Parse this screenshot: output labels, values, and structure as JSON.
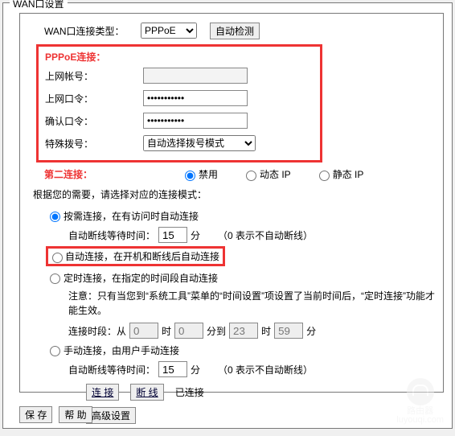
{
  "title": "WAN口设置",
  "wan_type": {
    "label": "WAN口连接类型：",
    "selected": "PPPoE",
    "auto_detect": "自动检测"
  },
  "pppoe": {
    "title": "PPPoE连接：",
    "user_label": "上网帐号：",
    "user_value": "",
    "pass_label": "上网口令：",
    "pass_value": "•••••••••••",
    "confirm_label": "确认口令：",
    "confirm_value": "•••••••••••",
    "dial_label": "特殊拨号：",
    "dial_selected": "自动选择拨号模式"
  },
  "second_conn": {
    "label": "第二连接：",
    "opt_disable": "禁用",
    "opt_dynamic": "动态 IP",
    "opt_static": "静态 IP",
    "selected": "disable"
  },
  "desc_text": "根据您的需要，请选择对应的连接模式：",
  "modes": {
    "ondemand": {
      "label": "按需连接，在有访问时自动连接",
      "wait_label": "自动断线等待时间：",
      "wait_value": "15",
      "wait_unit": "分",
      "wait_note": "（0 表示不自动断线）"
    },
    "auto": {
      "label": "自动连接，在开机和断线后自动连接"
    },
    "timed": {
      "label": "定时连接，在指定的时间段自动连接",
      "note": "注意：只有当您到“系统工具”菜单的“时间设置”项设置了当前时间后，“定时连接”功能才能生效。",
      "period_label": "连接时段：从",
      "from_h": "0",
      "h_unit": "时",
      "from_m": "0",
      "m_unit": "分到",
      "to_h": "23",
      "to_h_unit": "时",
      "to_m": "59",
      "to_m_unit": "分"
    },
    "manual": {
      "label": "手动连接，由用户手动连接",
      "wait_label": "自动断线等待时间：",
      "wait_value": "15",
      "wait_unit": "分",
      "wait_note": "（0 表示不自动断线）"
    }
  },
  "conn_btns": {
    "connect": "连 接",
    "disconnect": "断 线",
    "status": "已连接"
  },
  "adv_btn": "高级设置",
  "footer": {
    "save": "保 存",
    "help": "帮 助"
  },
  "watermark": {
    "text1": "路由器",
    "text2": "luyouqi.com"
  }
}
